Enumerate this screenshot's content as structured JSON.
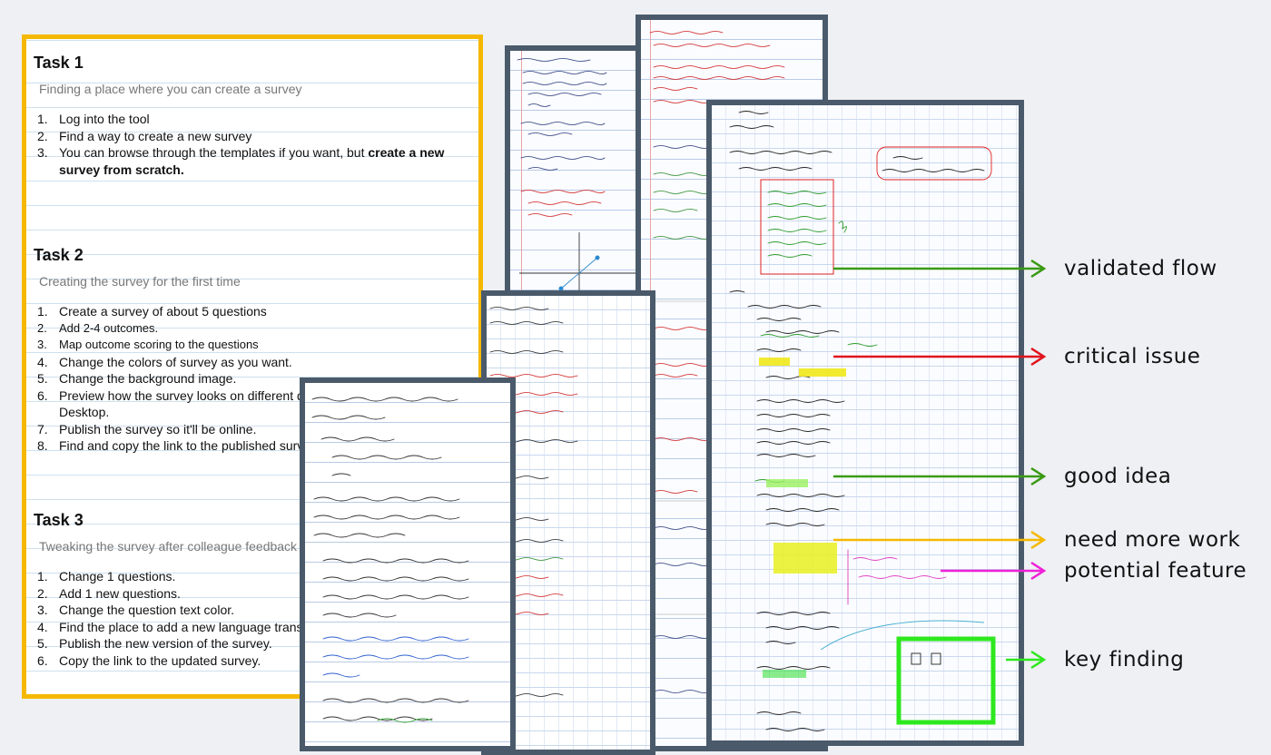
{
  "tasks": [
    {
      "title": "Task 1",
      "subtitle": "Finding a place where you can create a survey",
      "steps": [
        {
          "num": "1.",
          "text": "Log into the tool"
        },
        {
          "num": "2.",
          "text": "Find a way to create a new survey"
        },
        {
          "num": "3.",
          "text": "You can browse  through the templates if you want, but ",
          "bold": "create a new survey from scratch."
        }
      ]
    },
    {
      "title": "Task 2",
      "subtitle": "Creating the survey for the first time",
      "steps": [
        {
          "num": "1.",
          "text": "Create a survey of about 5 questions"
        },
        {
          "num": "2.",
          "text": "Add 2-4 outcomes."
        },
        {
          "num": "3.",
          "text": "Map outcome scoring to the questions"
        },
        {
          "num": "4.",
          "text": "Change the colors of survey as you want."
        },
        {
          "num": "5.",
          "text": "Change the background image."
        },
        {
          "num": "6.",
          "text": "Preview how the survey looks on different d Desktop."
        },
        {
          "num": "7.",
          "text": "Publish the survey so it'll be online."
        },
        {
          "num": "8.",
          "text": "Find and copy the link to the published surv"
        }
      ]
    },
    {
      "title": "Task 3",
      "subtitle": "Tweaking the survey after colleague feedback",
      "steps": [
        {
          "num": "1.",
          "text": "Change 1 questions."
        },
        {
          "num": "2.",
          "text": "Add 1 new questions."
        },
        {
          "num": "3.",
          "text": "Change the question text color."
        },
        {
          "num": "4.",
          "text": "Find the place to add a new language trans"
        },
        {
          "num": "5.",
          "text": "Publish the new version of the survey."
        },
        {
          "num": "6.",
          "text": "Copy the link to the updated survey."
        }
      ]
    }
  ],
  "legend": [
    {
      "label": "validated flow",
      "color": "#3a9a12"
    },
    {
      "label": "critical issue",
      "color": "#e0141c"
    },
    {
      "label": "good idea",
      "color": "#3a9a12"
    },
    {
      "label": "need more work",
      "color": "#f5b800"
    },
    {
      "label": "potential feature",
      "color": "#f020d8"
    },
    {
      "label": "key finding",
      "color": "#2ee81e"
    }
  ],
  "colors": {
    "sheet_border": "#f5b800",
    "note_border": "#4a5a6a",
    "background": "#eef0f4"
  }
}
